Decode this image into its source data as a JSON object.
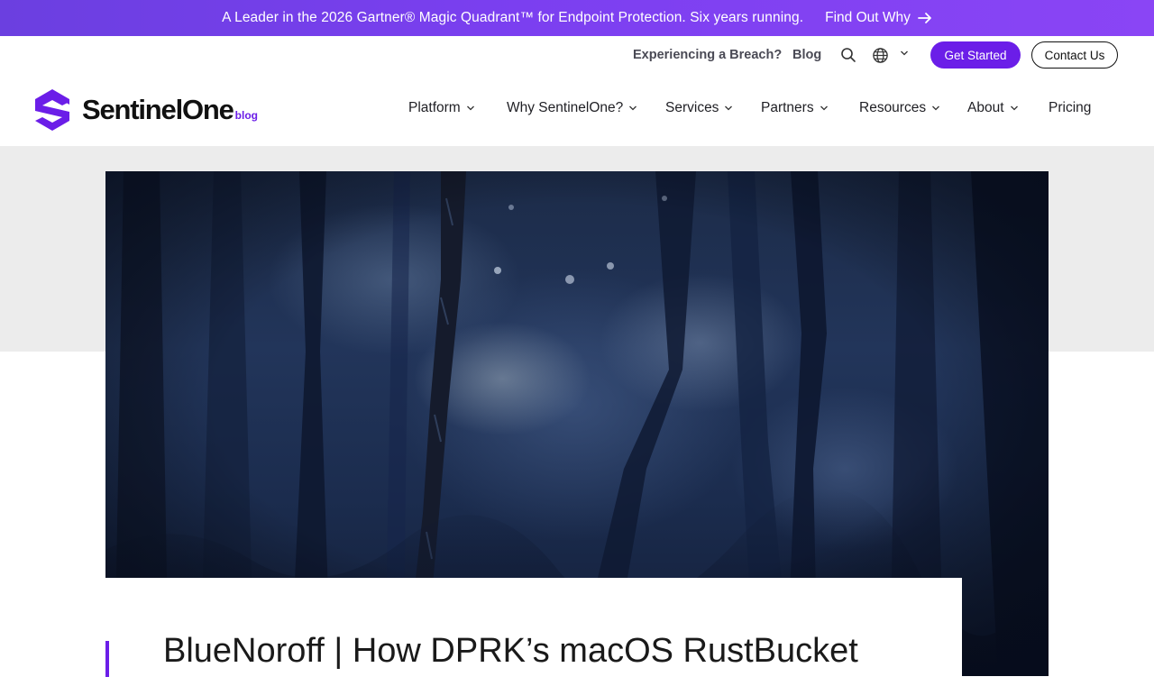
{
  "banner": {
    "message": "A Leader in the 2026 Gartner® Magic Quadrant™ for Endpoint Protection. Six years running.",
    "cta_label": "Find Out Why",
    "cta_icon": "arrow-right-icon"
  },
  "utility": {
    "breach_label": "Experiencing a Breach?",
    "blog_label": "Blog",
    "search_icon": "search-icon",
    "language_icon": "globe-icon",
    "get_started_label": "Get Started",
    "contact_label": "Contact Us"
  },
  "logo": {
    "name": "SentinelOne",
    "suffix": "blog"
  },
  "nav": {
    "items": [
      {
        "label": "Platform"
      },
      {
        "label": "Why SentinelOne?"
      },
      {
        "label": "Services"
      },
      {
        "label": "Partners"
      },
      {
        "label": "Resources"
      },
      {
        "label": "About"
      },
      {
        "label": "Pricing"
      }
    ]
  },
  "article": {
    "title": "BlueNoroff | How DPRK’s macOS RustBucket"
  },
  "colors": {
    "brand_purple": "#6b1ee8",
    "banner_gradient_start": "#6b3fe0",
    "banner_gradient_end": "#8a45f5",
    "hero_background": "#ececec"
  }
}
